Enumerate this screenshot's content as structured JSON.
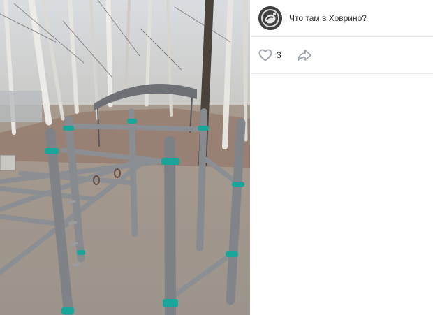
{
  "post": {
    "group_title": "Что там в Ховрино?",
    "likes_count": "3"
  },
  "icons": {
    "avatar": "group-avatar-logo",
    "like": "heart-icon",
    "share": "share-arrow-icon"
  },
  "colors": {
    "icon_gray": "#99a2ad",
    "text": "#2c2d2e",
    "divider": "#e7e8ec"
  }
}
